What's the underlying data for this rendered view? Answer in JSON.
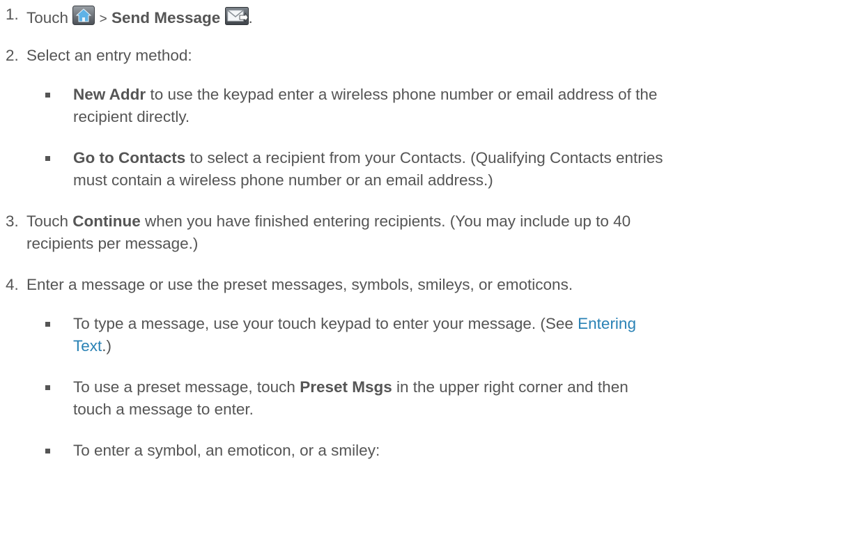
{
  "step1": {
    "num": "1.",
    "touch": "Touch",
    "sep": ">",
    "send_message": "Send Message",
    "end": ".",
    "icons": [
      "home-icon",
      "send-message-icon"
    ]
  },
  "step2": {
    "num": "2.",
    "text": "Select an entry method:",
    "bullets": [
      {
        "bold": "New Addr",
        "line1": " to use the keypad enter a wireless phone number or email address of the",
        "line2": "recipient directly."
      },
      {
        "bold": "Go to Contacts",
        "line1": " to select a recipient from your Contacts. (Qualifying Contacts entries",
        "line2": "must contain a wireless phone number or an email address.)"
      }
    ]
  },
  "step3": {
    "num": "3.",
    "pre": "Touch ",
    "bold": "Continue",
    "line1": " when you have finished entering recipients. (You may include up to 40",
    "line2": "recipients per message.)"
  },
  "step4": {
    "num": "4.",
    "text": "Enter a message or use the preset messages, symbols, smileys, or emoticons.",
    "bullets": [
      {
        "line1": "To type a message, use your touch keypad to enter your message. (See ",
        "link_part1": "Entering",
        "link_part2": "Text",
        "line2_end": ".)"
      },
      {
        "pre": "To use a preset message, touch ",
        "bold": "Preset Msgs",
        "line1": " in the upper right corner and then",
        "line2": "touch a message to enter."
      },
      {
        "line1": "To enter a symbol, an emoticon, or a smiley:"
      }
    ]
  },
  "colors": {
    "text": "#555555",
    "link": "#2a82b5"
  }
}
